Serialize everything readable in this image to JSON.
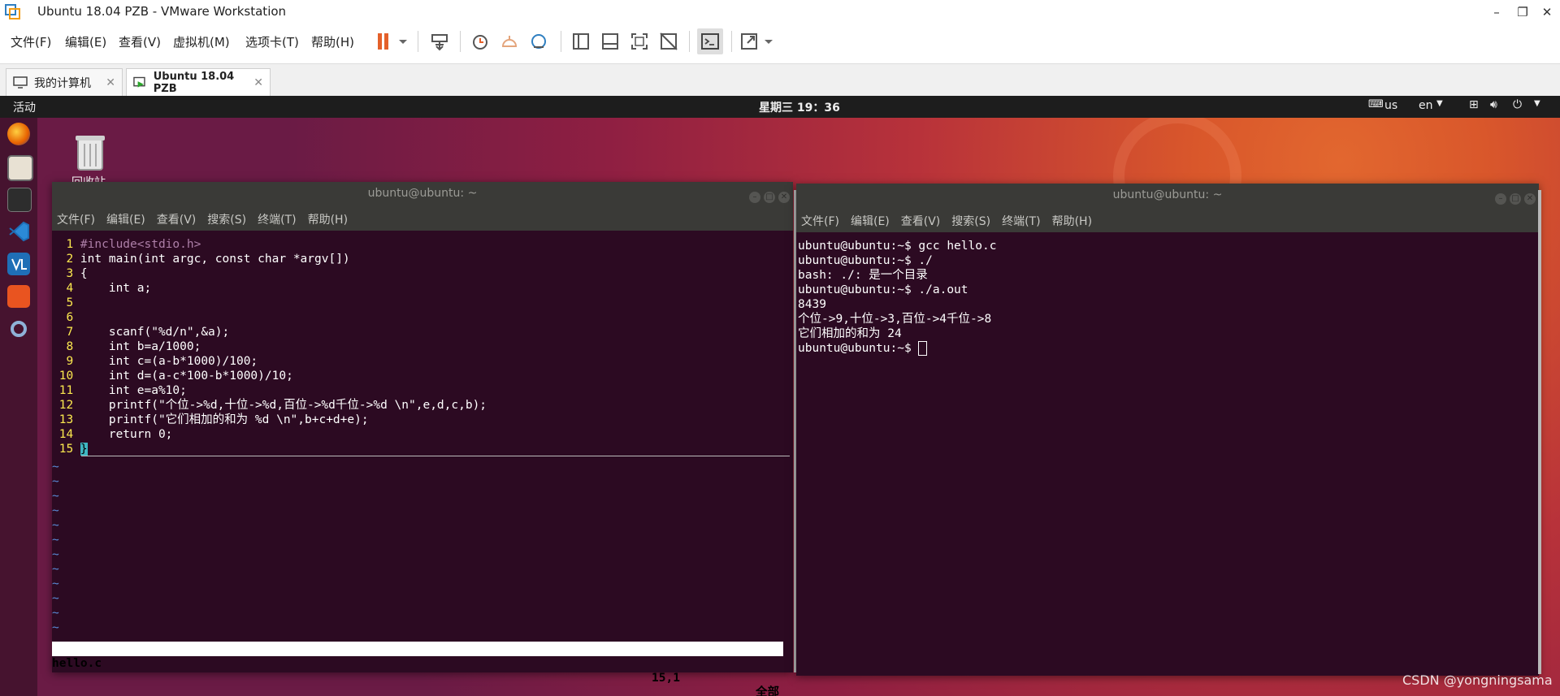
{
  "app": {
    "title": "Ubuntu 18.04 PZB - VMware Workstation",
    "menu": [
      "文件(F)",
      "编辑(E)",
      "查看(V)",
      "虚拟机(M)",
      "选项卡(T)",
      "帮助(H)"
    ],
    "tabs": [
      "我的计算机",
      "Ubuntu 18.04 PZB"
    ]
  },
  "desktop": {
    "activities": "活动",
    "clock": "星期三 19：36",
    "keyboard": "us",
    "lang": "en",
    "trash_label": "回收站"
  },
  "vim": {
    "title": "ubuntu@ubuntu: ~",
    "menu": [
      "文件(F)",
      "编辑(E)",
      "查看(V)",
      "搜索(S)",
      "终端(T)",
      "帮助(H)"
    ],
    "lines": [
      "#include<stdio.h>",
      "int main(int argc, const char *argv[])",
      "{",
      "    int a;",
      "",
      "",
      "    scanf(\"%d/n\",&a);",
      "    int b=a/1000;",
      "    int c=(a-b*1000)/100;",
      "    int d=(a-c*100-b*1000)/10;",
      "    int e=a%10;",
      "    printf(\"个位->%d,十位->%d,百位->%d千位->%d \\n\",e,d,c,b);",
      "    printf(\"它们相加的和为 %d \\n\",b+c+d+e);",
      "    return 0;",
      "}"
    ],
    "status_file": "hello.c",
    "status_pos": "15,1",
    "status_all": "全部"
  },
  "shell": {
    "title": "ubuntu@ubuntu: ~",
    "menu": [
      "文件(F)",
      "编辑(E)",
      "查看(V)",
      "搜索(S)",
      "终端(T)",
      "帮助(H)"
    ],
    "lines": [
      "ubuntu@ubuntu:~$ gcc hello.c",
      "ubuntu@ubuntu:~$ ./",
      "bash: ./: 是一个目录",
      "ubuntu@ubuntu:~$ ./a.out",
      "8439",
      "个位->9,十位->3,百位->4千位->8",
      "它们相加的和为 24",
      "ubuntu@ubuntu:~$ "
    ]
  },
  "watermark": "CSDN @yongningsama"
}
